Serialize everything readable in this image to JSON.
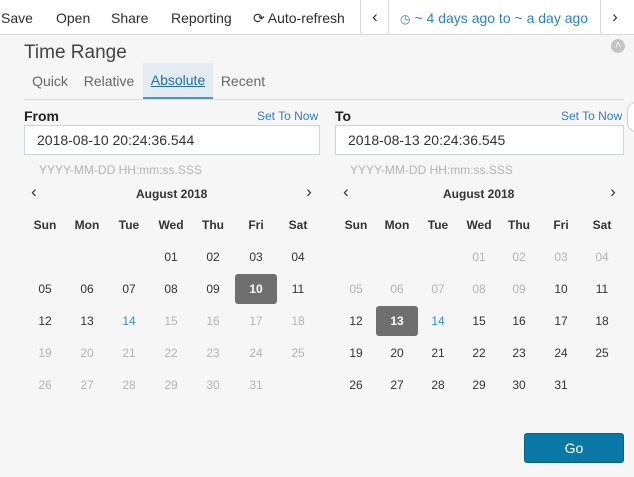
{
  "nav": {
    "save": "Save",
    "open": "Open",
    "share": "Share",
    "reporting": "Reporting",
    "auto_refresh": "Auto-refresh",
    "time_range": "~ 4 days ago to ~ a day ago",
    "prev_icon": "chevron-left-icon",
    "next_icon": "chevron-right-icon"
  },
  "panel": {
    "title": "Time Range",
    "tabs": [
      {
        "label": "Quick",
        "active": false
      },
      {
        "label": "Relative",
        "active": false
      },
      {
        "label": "Absolute",
        "active": true
      },
      {
        "label": "Recent",
        "active": false
      }
    ],
    "from": {
      "label": "From",
      "set_to_now": "Set To Now",
      "value": "2018-08-10 20:24:36.544",
      "format_hint": "YYYY-MM-DD HH:mm:ss.SSS",
      "calendar": {
        "month_label": "August 2018",
        "weekdays": [
          "Sun",
          "Mon",
          "Tue",
          "Wed",
          "Thu",
          "Fri",
          "Sat"
        ],
        "weeks": [
          [
            {
              "d": "",
              "s": ""
            },
            {
              "d": "",
              "s": ""
            },
            {
              "d": "",
              "s": ""
            },
            {
              "d": "01",
              "s": ""
            },
            {
              "d": "02",
              "s": ""
            },
            {
              "d": "03",
              "s": ""
            },
            {
              "d": "04",
              "s": ""
            }
          ],
          [
            {
              "d": "05",
              "s": ""
            },
            {
              "d": "06",
              "s": ""
            },
            {
              "d": "07",
              "s": ""
            },
            {
              "d": "08",
              "s": ""
            },
            {
              "d": "09",
              "s": ""
            },
            {
              "d": "10",
              "s": "selected"
            },
            {
              "d": "11",
              "s": ""
            }
          ],
          [
            {
              "d": "12",
              "s": ""
            },
            {
              "d": "13",
              "s": ""
            },
            {
              "d": "14",
              "s": "today"
            },
            {
              "d": "15",
              "s": "muted"
            },
            {
              "d": "16",
              "s": "muted"
            },
            {
              "d": "17",
              "s": "muted"
            },
            {
              "d": "18",
              "s": "muted"
            }
          ],
          [
            {
              "d": "19",
              "s": "muted"
            },
            {
              "d": "20",
              "s": "muted"
            },
            {
              "d": "21",
              "s": "muted"
            },
            {
              "d": "22",
              "s": "muted"
            },
            {
              "d": "23",
              "s": "muted"
            },
            {
              "d": "24",
              "s": "muted"
            },
            {
              "d": "25",
              "s": "muted"
            }
          ],
          [
            {
              "d": "26",
              "s": "muted"
            },
            {
              "d": "27",
              "s": "muted"
            },
            {
              "d": "28",
              "s": "muted"
            },
            {
              "d": "29",
              "s": "muted"
            },
            {
              "d": "30",
              "s": "muted"
            },
            {
              "d": "31",
              "s": "muted"
            },
            {
              "d": "",
              "s": ""
            }
          ]
        ]
      }
    },
    "to": {
      "label": "To",
      "set_to_now": "Set To Now",
      "value": "2018-08-13 20:24:36.545",
      "format_hint": "YYYY-MM-DD HH:mm:ss.SSS",
      "calendar": {
        "month_label": "August 2018",
        "weekdays": [
          "Sun",
          "Mon",
          "Tue",
          "Wed",
          "Thu",
          "Fri",
          "Sat"
        ],
        "weeks": [
          [
            {
              "d": "",
              "s": ""
            },
            {
              "d": "",
              "s": ""
            },
            {
              "d": "",
              "s": ""
            },
            {
              "d": "01",
              "s": "muted"
            },
            {
              "d": "02",
              "s": "muted"
            },
            {
              "d": "03",
              "s": "muted"
            },
            {
              "d": "04",
              "s": "muted"
            }
          ],
          [
            {
              "d": "05",
              "s": "muted"
            },
            {
              "d": "06",
              "s": "muted"
            },
            {
              "d": "07",
              "s": "muted"
            },
            {
              "d": "08",
              "s": "muted"
            },
            {
              "d": "09",
              "s": "muted"
            },
            {
              "d": "10",
              "s": ""
            },
            {
              "d": "11",
              "s": ""
            }
          ],
          [
            {
              "d": "12",
              "s": ""
            },
            {
              "d": "13",
              "s": "selected"
            },
            {
              "d": "14",
              "s": "today"
            },
            {
              "d": "15",
              "s": ""
            },
            {
              "d": "16",
              "s": ""
            },
            {
              "d": "17",
              "s": ""
            },
            {
              "d": "18",
              "s": ""
            }
          ],
          [
            {
              "d": "19",
              "s": ""
            },
            {
              "d": "20",
              "s": ""
            },
            {
              "d": "21",
              "s": ""
            },
            {
              "d": "22",
              "s": ""
            },
            {
              "d": "23",
              "s": ""
            },
            {
              "d": "24",
              "s": ""
            },
            {
              "d": "25",
              "s": ""
            }
          ],
          [
            {
              "d": "26",
              "s": ""
            },
            {
              "d": "27",
              "s": ""
            },
            {
              "d": "28",
              "s": ""
            },
            {
              "d": "29",
              "s": ""
            },
            {
              "d": "30",
              "s": ""
            },
            {
              "d": "31",
              "s": ""
            },
            {
              "d": "",
              "s": ""
            }
          ]
        ]
      }
    },
    "go": "Go"
  },
  "colors": {
    "accent": "#2f7fbf",
    "go_button": "#0b79a8",
    "selected_day": "#6f6f6f",
    "panel_background": "#f6f6f6",
    "muted_text": "#b3b3b3"
  }
}
